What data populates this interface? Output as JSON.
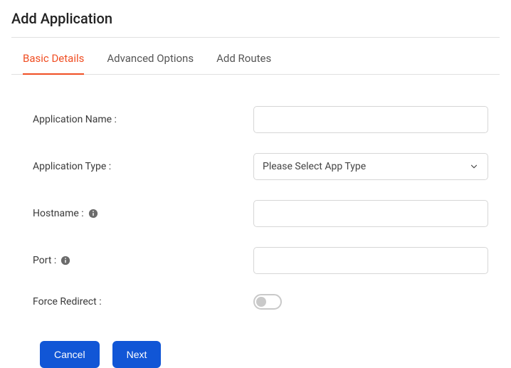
{
  "header": {
    "title": "Add Application"
  },
  "tabs": {
    "items": [
      {
        "label": "Basic Details",
        "active": true
      },
      {
        "label": "Advanced Options",
        "active": false
      },
      {
        "label": "Add Routes",
        "active": false
      }
    ]
  },
  "form": {
    "app_name_label": "Application Name :",
    "app_name_value": "",
    "app_type_label": "Application Type :",
    "app_type_selected": "Please Select App Type",
    "hostname_label": "Hostname :",
    "hostname_value": "",
    "port_label": "Port :",
    "port_value": "",
    "force_redirect_label": "Force Redirect :",
    "force_redirect_on": false
  },
  "actions": {
    "cancel": "Cancel",
    "next": "Next"
  }
}
